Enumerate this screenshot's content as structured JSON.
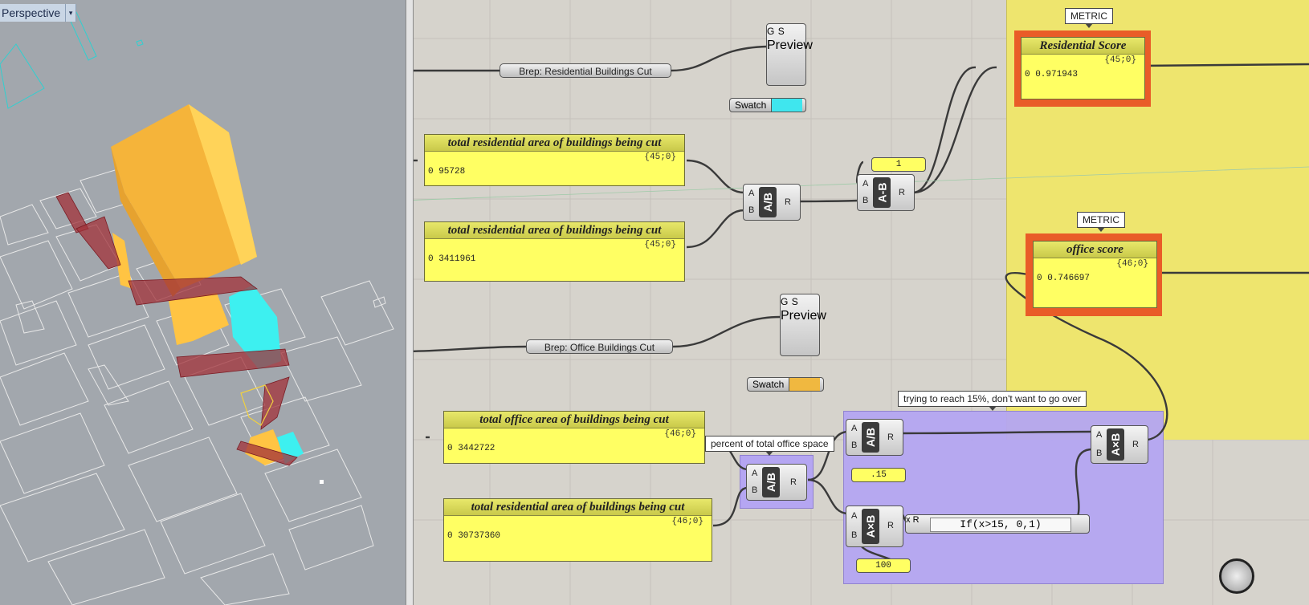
{
  "viewport": {
    "title": "Perspective",
    "menu_arrow": "▾",
    "colors": {
      "background": "#a2a7ad",
      "residential": "#ffc443",
      "office": "#3df0f0",
      "cut": "#a1313a",
      "outline": "#e8e8e8"
    }
  },
  "canvas": {
    "groups": [
      {
        "name": "metric-group",
        "color": "#f0e86c"
      },
      {
        "name": "office-calc-group",
        "color": "#b5a6f2"
      }
    ],
    "brep_components": [
      {
        "label": "Brep: Residential Buildings Cut"
      },
      {
        "label": "Brep: Office Buildings Cut"
      }
    ],
    "preview_components": [
      {
        "inputs": [
          "G",
          "S"
        ],
        "label": "Preview",
        "swatch_label": "Swatch",
        "swatch_color": "#3fe6ee"
      },
      {
        "inputs": [
          "G",
          "S"
        ],
        "label": "Preview",
        "swatch_label": "Swatch",
        "swatch_color": "#f0b840"
      }
    ],
    "panels": [
      {
        "title": "total residential area of buildings being cut",
        "index": "{45;0}",
        "value": "0 95728"
      },
      {
        "title": "total residential area of buildings being cut",
        "index": "{45;0}",
        "value": "0 3411961"
      },
      {
        "title": "total office area of buildings being cut",
        "index": "{46;0}",
        "value": "0 3442722"
      },
      {
        "title": "total residential area of buildings being cut",
        "index": "{46;0}",
        "value": "0 30737360"
      }
    ],
    "metrics": [
      {
        "bubble": "METRIC",
        "title": "Residential Score",
        "index": "{45;0}",
        "value": "0 0.971943"
      },
      {
        "bubble": "METRIC",
        "title": "office score",
        "index": "{46;0}",
        "value": "0 0.746697"
      }
    ],
    "operators": {
      "divide": "A/B",
      "subtract": "A-B",
      "multiply": "A×B",
      "input_a": "A",
      "input_b": "B",
      "output_r": "R",
      "input_x": "x"
    },
    "number_sliders": {
      "one": "1",
      "fifteen": ".15",
      "hundred": "100"
    },
    "expression": "If(x>15, 0,1)",
    "bubbles": {
      "percent": "percent of total office space",
      "trying": "trying to reach 15%, don't want to go over"
    }
  }
}
